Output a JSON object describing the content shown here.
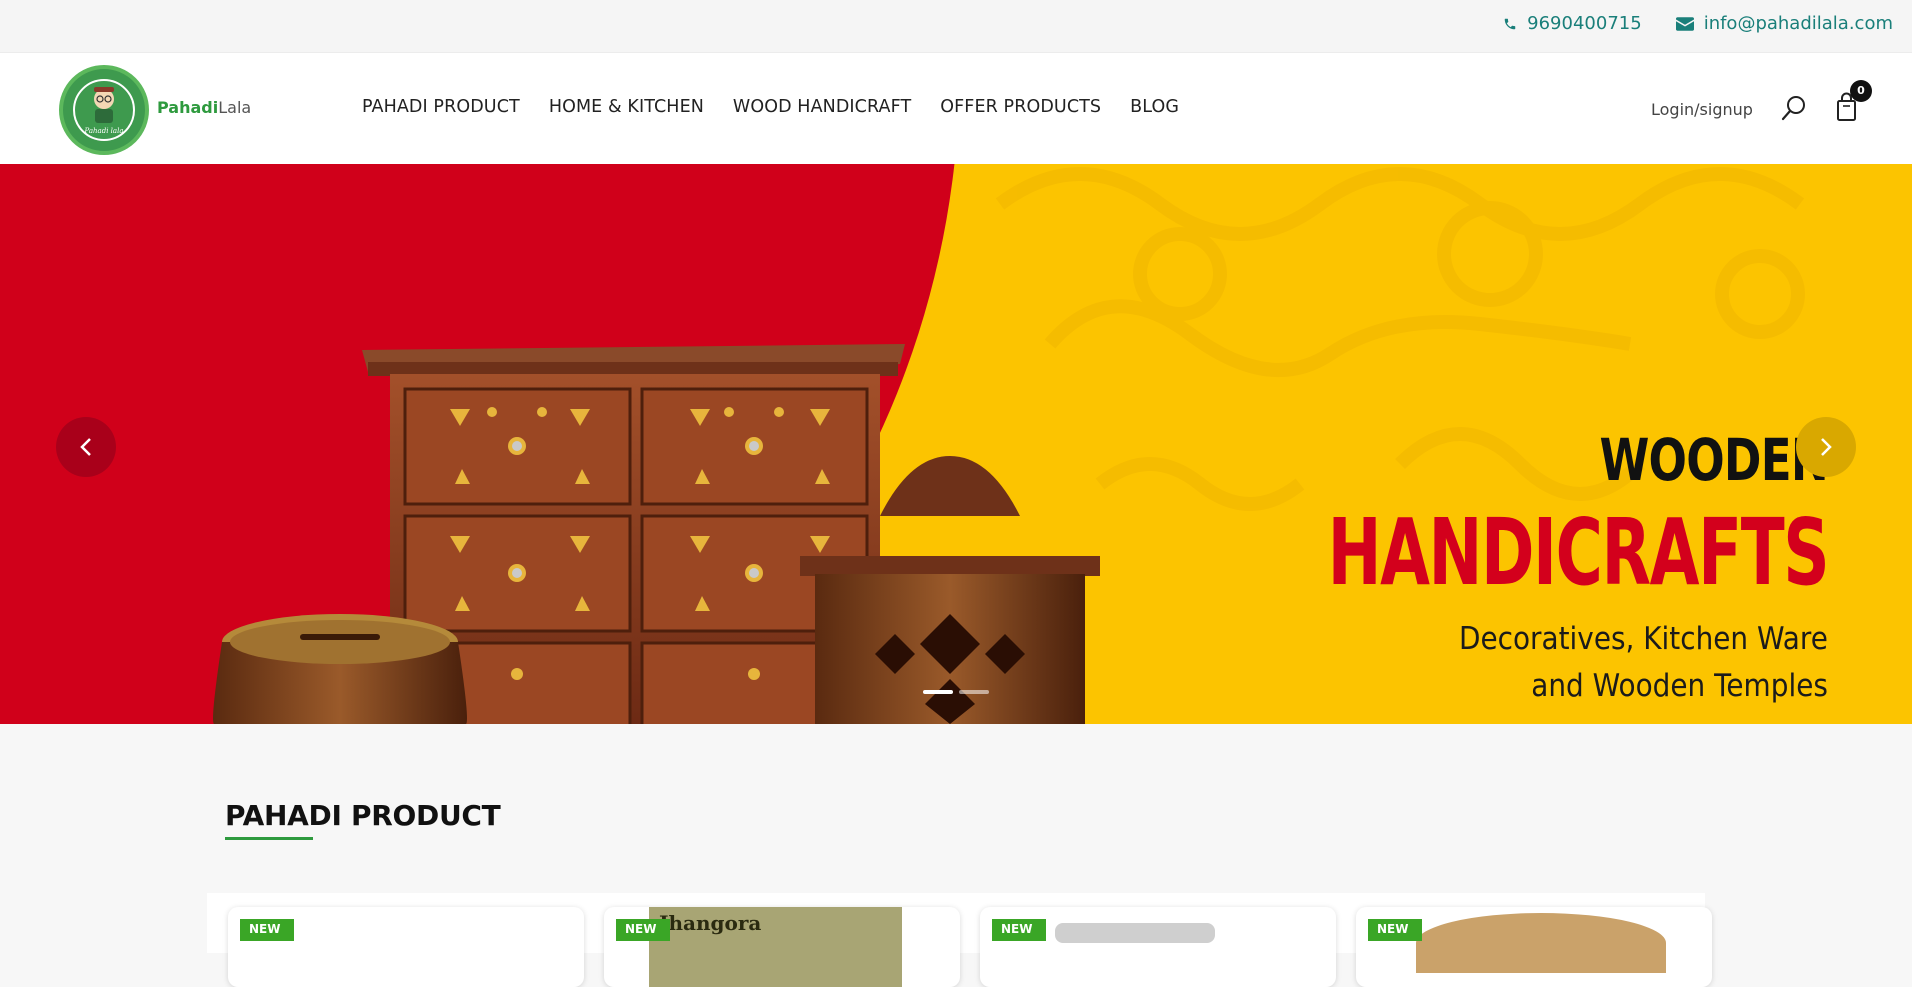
{
  "topbar": {
    "phone": "9690400715",
    "email": "info@pahadilala.com",
    "phone_icon": "phone-icon",
    "email_icon": "envelope-icon"
  },
  "header": {
    "logo_text_bold": "Pahadi",
    "logo_text_rest": "Lala",
    "nav": [
      {
        "label": "PAHADI PRODUCT"
      },
      {
        "label": "HOME & KITCHEN"
      },
      {
        "label": "WOOD HANDICRAFT"
      },
      {
        "label": "OFFER PRODUCTS"
      },
      {
        "label": "BLOG"
      }
    ],
    "login_label": "Login/signup",
    "cart_count": "0"
  },
  "banner": {
    "line1": "WOODEN",
    "line2": "HANDICRAFTS",
    "line3": "Decoratives, Kitchen Ware",
    "line4": "and Wooden Temples",
    "active_slide": 1,
    "slide_count": 2,
    "colors": {
      "red": "#d0001a",
      "yellow": "#fcc400"
    }
  },
  "section": {
    "title": "PAHADI PRODUCT"
  },
  "products": [
    {
      "badge": "NEW"
    },
    {
      "badge": "NEW",
      "thumb_text": "Jhangora"
    },
    {
      "badge": "NEW"
    },
    {
      "badge": "NEW"
    }
  ]
}
